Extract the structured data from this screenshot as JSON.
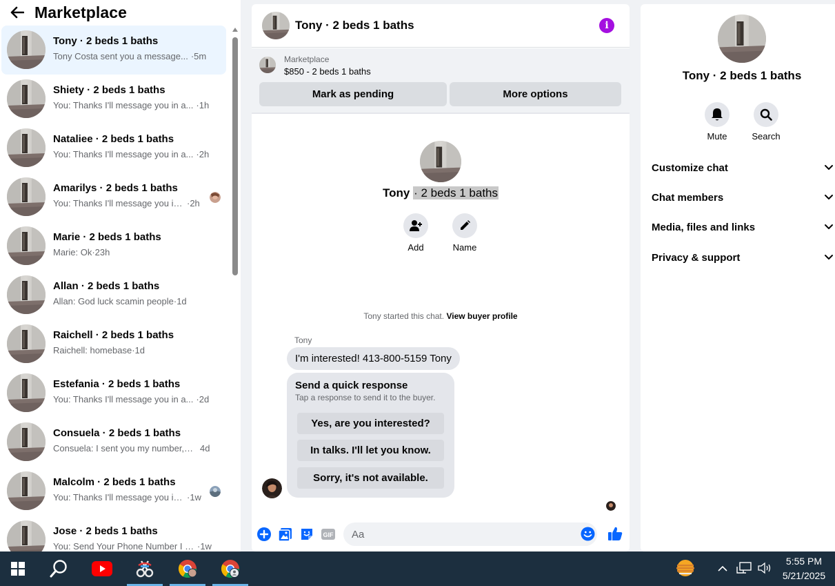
{
  "sidebar": {
    "title": "Marketplace",
    "conversations": [
      {
        "name": "Tony · 2 beds 1 baths",
        "preview": "Tony Costa sent you a message...",
        "time": "·5m"
      },
      {
        "name": "Shiety · 2 beds 1 baths",
        "preview": "You: Thanks I'll message you in a...",
        "time": "·1h"
      },
      {
        "name": "Nataliee · 2 beds 1 baths",
        "preview": "You: Thanks I'll message you in a...",
        "time": "·2h"
      },
      {
        "name": "Amarilys · 2 beds 1 baths",
        "preview": "You: Thanks I'll message you in a...",
        "time": "·2h"
      },
      {
        "name": "Marie · 2 beds 1 baths",
        "preview": "Marie: Ok",
        "time": "·23h"
      },
      {
        "name": "Allan · 2 beds 1 baths",
        "preview": "Allan: God luck scamin people",
        "time": "·1d"
      },
      {
        "name": "Raichell · 2 beds 1 baths",
        "preview": "Raichell: homebase",
        "time": "·1d"
      },
      {
        "name": "Estefania · 2 beds 1 baths",
        "preview": "You: Thanks I'll message you in a...",
        "time": "·2d"
      },
      {
        "name": "Consuela · 2 beds 1 baths",
        "preview": "Consuela: I sent you my number, I...",
        "time": "4d"
      },
      {
        "name": "Malcolm · 2 beds 1 baths",
        "preview": "You: Thanks I'll message you in ...",
        "time": "·1w"
      },
      {
        "name": "Jose · 2 beds 1 baths",
        "preview": "You: Send Your Phone Number I W...",
        "time": "·1w"
      }
    ]
  },
  "chat": {
    "title": "Tony · 2 beds 1 baths",
    "marketplace_label": "Marketplace",
    "listing": "$850 - 2 beds 1 baths",
    "mark_pending": "Mark as pending",
    "more_options": "More options",
    "profile_name_first": "Tony",
    "profile_name_rest": "· 2 beds 1 baths",
    "add_label": "Add",
    "name_label": "Name",
    "started_text": "Tony started this chat.",
    "view_buyer_profile": "View buyer profile",
    "sender": "Tony",
    "message": "I'm interested! 413-800-5159 Tony",
    "quick_title": "Send a quick response",
    "quick_subtitle": "Tap a response to send it to the buyer.",
    "quick_responses": [
      "Yes, are you interested?",
      "In talks. I'll let you know.",
      "Sorry, it's not available."
    ],
    "input_placeholder": "Aa"
  },
  "details": {
    "name": "Tony · 2 beds 1 baths",
    "mute": "Mute",
    "search": "Search",
    "sections": [
      "Customize chat",
      "Chat members",
      "Media, files and links",
      "Privacy & support"
    ]
  },
  "taskbar": {
    "time": "5:55 PM",
    "date": "5/21/2025"
  },
  "colors": {
    "accent": "#0866ff",
    "info_purple": "#a40fe0",
    "active_row": "#ebf5ff",
    "taskbar": "#1c2f3f"
  }
}
